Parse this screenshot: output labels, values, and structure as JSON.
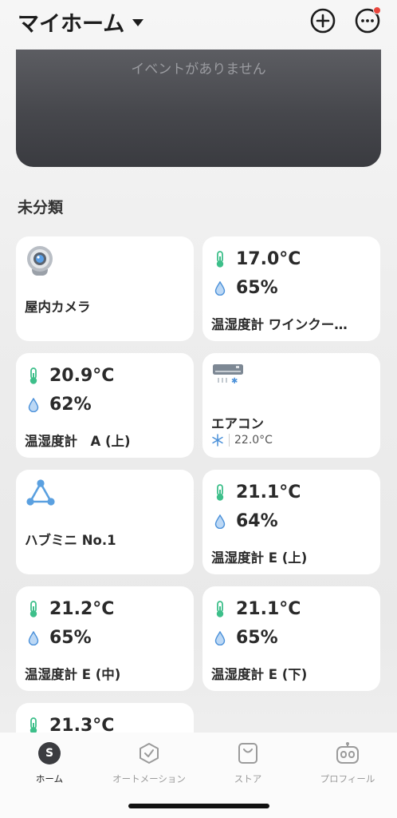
{
  "header": {
    "title": "マイホーム",
    "icons": {
      "add": "plus-circle-icon",
      "more": "more-dots-icon"
    }
  },
  "event_banner": {
    "text": "イベントがありません"
  },
  "section": {
    "title": "未分類"
  },
  "devices": {
    "camera": {
      "name": "屋内カメラ",
      "icon": "camera-icon"
    },
    "thermo_wine": {
      "temp": "17.0°C",
      "humidity": "65%",
      "name": "温湿度計 ワインクー…"
    },
    "thermo_a": {
      "temp": "20.9°C",
      "humidity": "62%",
      "name": "温湿度計　A (上)"
    },
    "aircon": {
      "name": "エアコン",
      "status": "22.0°C",
      "icon": "air-conditioner-icon"
    },
    "hub": {
      "name": "ハブミニ No.1",
      "icon": "hub-icon"
    },
    "thermo_e_upper": {
      "temp": "21.1°C",
      "humidity": "64%",
      "name": "温湿度計 E (上)"
    },
    "thermo_e_mid": {
      "temp": "21.2°C",
      "humidity": "65%",
      "name": "温湿度計 E (中)"
    },
    "thermo_e_lower": {
      "temp": "21.1°C",
      "humidity": "65%",
      "name": "温湿度計 E (下)"
    },
    "thermo_partial": {
      "temp": "21.3°C"
    }
  },
  "nav": {
    "home": {
      "label": "ホーム",
      "letter": "S"
    },
    "automation": {
      "label": "オートメーション"
    },
    "store": {
      "label": "ストア"
    },
    "profile": {
      "label": "プロフィール"
    }
  },
  "colors": {
    "thermo_green": "#3dbf8a",
    "water_blue": "#4a90d9",
    "banner": "#46474c",
    "alert_red": "#e8453c"
  }
}
